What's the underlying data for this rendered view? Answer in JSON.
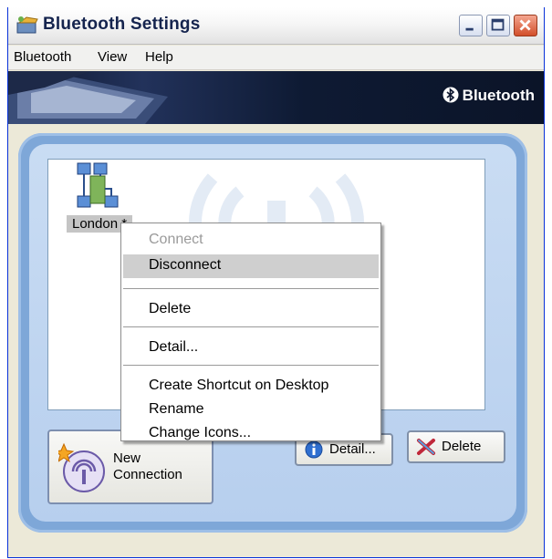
{
  "window": {
    "title": "Bluetooth Settings",
    "controls": [
      "minimize",
      "maximize",
      "close"
    ]
  },
  "menubar": {
    "items": [
      "Bluetooth",
      "View",
      "Help"
    ]
  },
  "banner": {
    "brand": "Bluetooth"
  },
  "device_list": {
    "devices": [
      {
        "label": "London *",
        "icon": "network-computer-icon",
        "selected": true
      }
    ]
  },
  "context_menu": {
    "items": [
      {
        "label": "Connect",
        "disabled": true
      },
      {
        "label": "Disconnect",
        "highlighted": true
      },
      {
        "label": "Delete"
      },
      {
        "label": "Detail..."
      },
      {
        "label": "Create Shortcut on Desktop"
      },
      {
        "label": "Rename"
      },
      {
        "label": "Change Icons..."
      }
    ]
  },
  "buttons": {
    "new_connection": "New\nConnection",
    "detail": "Detail...",
    "delete": "Delete"
  },
  "colors": {
    "panel_blue": "#7ea7d8",
    "banner_dark": "#0f1830",
    "highlight_gray": "#cfcfcf"
  }
}
